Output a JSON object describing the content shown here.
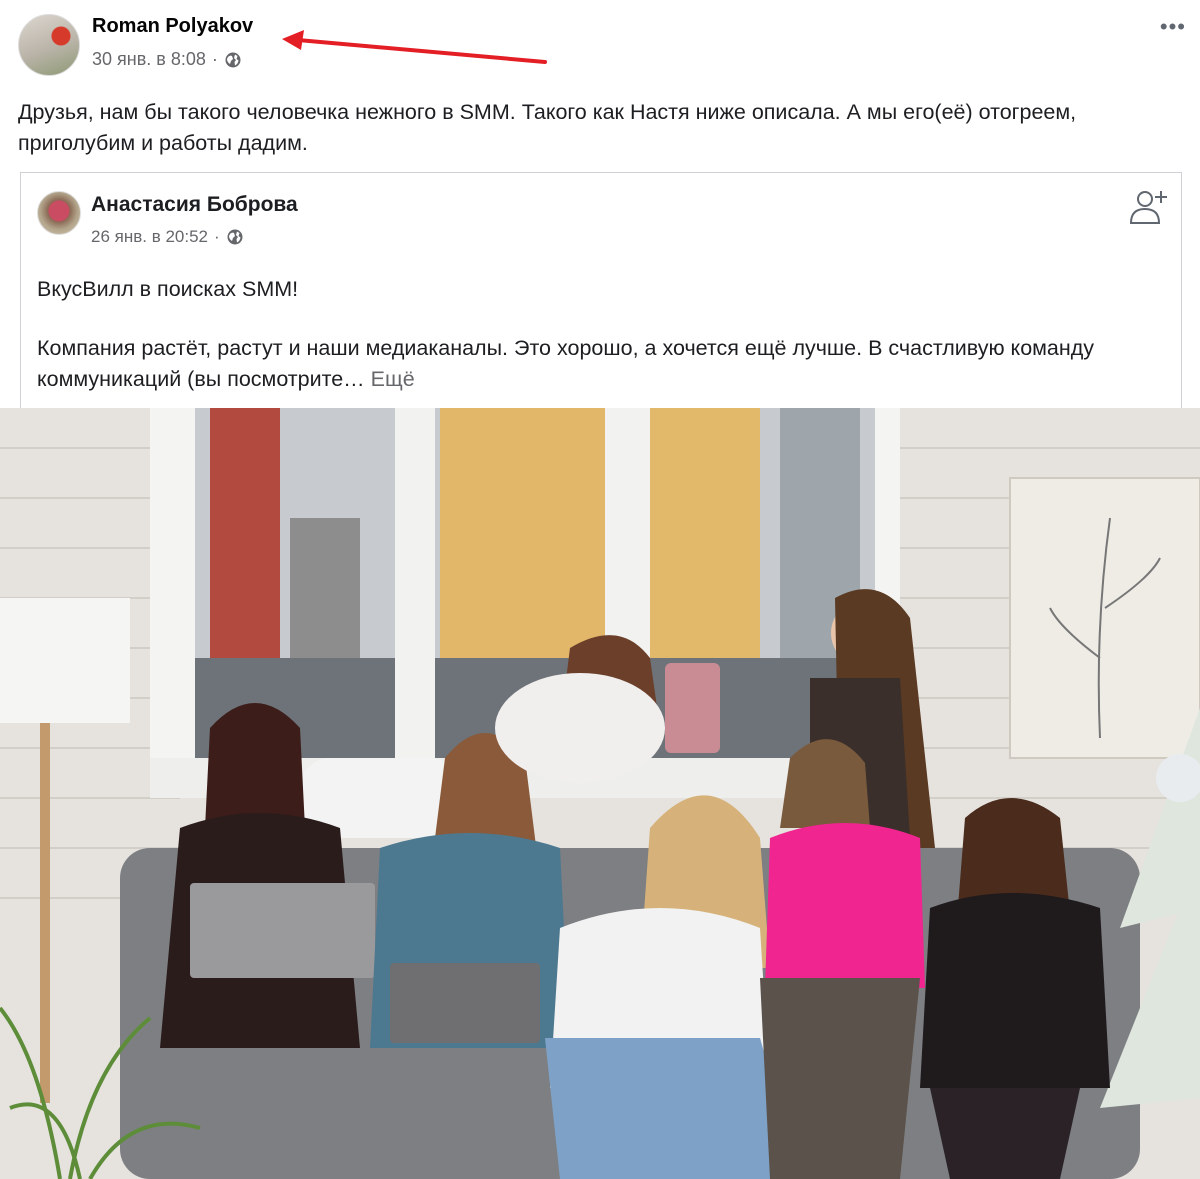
{
  "post": {
    "author": "Roman Polyakov",
    "timestamp": "30 янв. в 8:08",
    "separator": "·",
    "privacy_icon": "globe-icon",
    "more_icon": "ellipsis-icon",
    "text": "Друзья, нам бы такого человечка нежного в SMM. Такого как Настя ниже описала. А мы его(её) отогреем, приголубим и работы дадим."
  },
  "annotation": {
    "arrow_color": "#e41e25"
  },
  "shared_post": {
    "author": "Анастасия Боброва",
    "timestamp": "26 янв. в 20:52",
    "separator": "·",
    "privacy_icon": "globe-icon",
    "action_icon": "add-friend-icon",
    "headline": "ВкусВилл в поисках SMM!",
    "paragraph": "Компания растёт, растут и наши медиаканалы. Это хорошо, а хочется ещё лучше. В счастливую команду коммуникаций (вы посмотрите… ",
    "see_more": "Ещё"
  },
  "photo": {
    "subject": "group-photo"
  }
}
